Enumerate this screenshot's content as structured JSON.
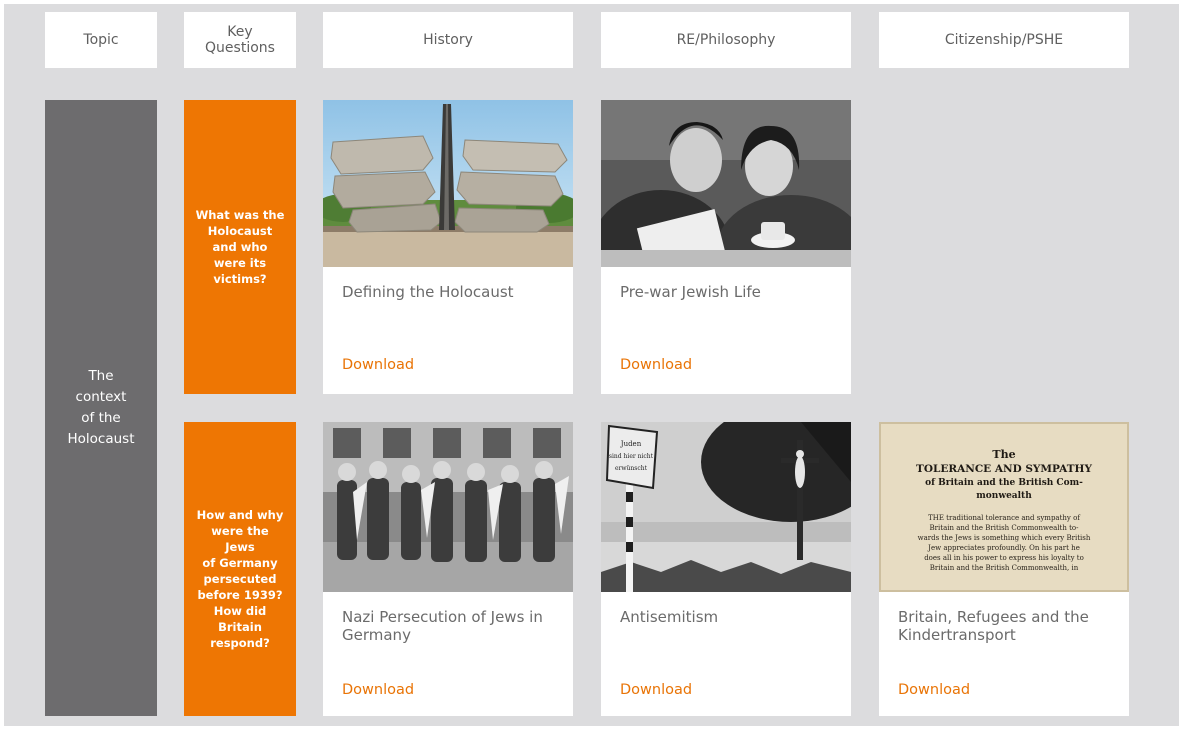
{
  "headers": {
    "topic": "Topic",
    "key_questions_line1": "Key",
    "key_questions_line2": "Questions",
    "history": "History",
    "re_philosophy": "RE/Philosophy",
    "citizenship": "Citizenship/PSHE"
  },
  "topic": {
    "line1": "The context",
    "line2": "of the",
    "line3": "Holocaust"
  },
  "key_questions": [
    {
      "lines": [
        "What was the",
        "Holocaust",
        "and who",
        "were its",
        "victims?"
      ]
    },
    {
      "lines": [
        "How and why",
        "were the Jews",
        "of Germany",
        "persecuted",
        "before 1939?",
        "How did",
        "Britain",
        "respond?"
      ]
    }
  ],
  "cards": {
    "defining": {
      "title": "Defining the Holocaust",
      "download": "Download",
      "image": "memorial-sculpture-photo"
    },
    "prewar": {
      "title": "Pre-war Jewish Life",
      "download": "Download",
      "image": "couple-cafe-photo"
    },
    "nazi": {
      "title": "Nazi Persecution of Jews in Germany",
      "download": "Download",
      "image": "schoolchildren-photo"
    },
    "antisemitism": {
      "title": "Antisemitism",
      "download": "Download",
      "image": "sign-and-crucifix-photo"
    },
    "britain": {
      "title": "Britain, Refugees and the Kindertransport",
      "download": "Download",
      "image": "newspaper-clipping"
    }
  },
  "clipping": {
    "heading1": "The",
    "heading2": "TOLERANCE AND SYMPATHY",
    "heading3": "of Britain and the British Com-",
    "heading4": "monwealth",
    "body1": "THE traditional tolerance and sympathy of",
    "body2": "Britain and the British Commonwealth to-",
    "body3": "wards the Jews is something which every British",
    "body4": "Jew appreciates profoundly. On his part he",
    "body5": "does all in his power to express his loyalty to",
    "body6": "Britain and the British Commonwealth, in"
  },
  "sign": {
    "line1": "Juden",
    "line2": "sind hier nicht",
    "line3": "erwünscht"
  },
  "colors": {
    "background": "#dcdcde",
    "topic_column": "#6d6c6e",
    "key_question": "#ee7603",
    "download_link": "#e97406"
  }
}
